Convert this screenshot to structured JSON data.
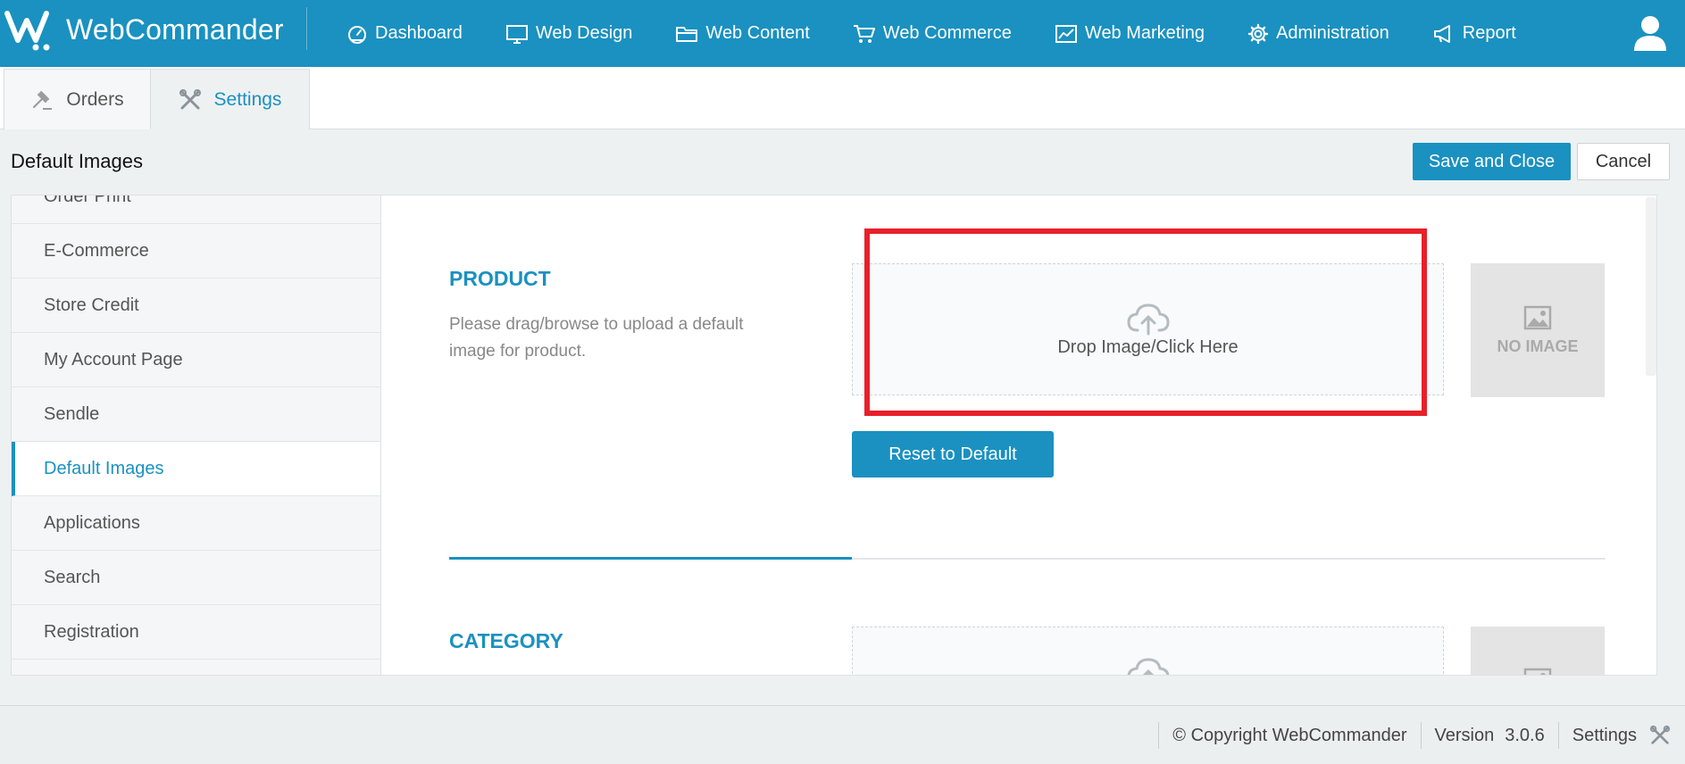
{
  "app": {
    "logo_text": "WebCommander"
  },
  "nav": {
    "items": [
      {
        "label": "Dashboard",
        "icon": "dashboard-icon"
      },
      {
        "label": "Web Design",
        "icon": "monitor-icon"
      },
      {
        "label": "Web Content",
        "icon": "folder-icon"
      },
      {
        "label": "Web Commerce",
        "icon": "cart-icon"
      },
      {
        "label": "Web Marketing",
        "icon": "chart-icon"
      },
      {
        "label": "Administration",
        "icon": "gear-icon"
      },
      {
        "label": "Report",
        "icon": "megaphone-icon"
      }
    ],
    "user_icon": "user-icon"
  },
  "tabs": [
    {
      "label": "Orders",
      "icon": "gavel-icon",
      "active": false
    },
    {
      "label": "Settings",
      "icon": "tools-icon",
      "active": true
    }
  ],
  "page": {
    "title": "Default Images",
    "save_label": "Save and Close",
    "cancel_label": "Cancel"
  },
  "sidebar": {
    "items": [
      {
        "label": "Order Print"
      },
      {
        "label": "E-Commerce"
      },
      {
        "label": "Store Credit"
      },
      {
        "label": "My Account Page"
      },
      {
        "label": "Sendle"
      },
      {
        "label": "Default Images",
        "active": true
      },
      {
        "label": "Applications"
      },
      {
        "label": "Search"
      },
      {
        "label": "Registration"
      }
    ]
  },
  "sections": {
    "product": {
      "title": "PRODUCT",
      "description": "Please drag/browse to upload a default image for product.",
      "drop_label": "Drop Image/Click Here",
      "no_image_label": "NO IMAGE",
      "reset_label": "Reset to Default"
    },
    "category": {
      "title": "CATEGORY"
    }
  },
  "footer": {
    "copyright": "© Copyright WebCommander",
    "version_label": "Version",
    "version_value": "3.0.6",
    "settings_label": "Settings"
  },
  "colors": {
    "brand": "#1a91c0",
    "highlight": "#e8202a"
  }
}
